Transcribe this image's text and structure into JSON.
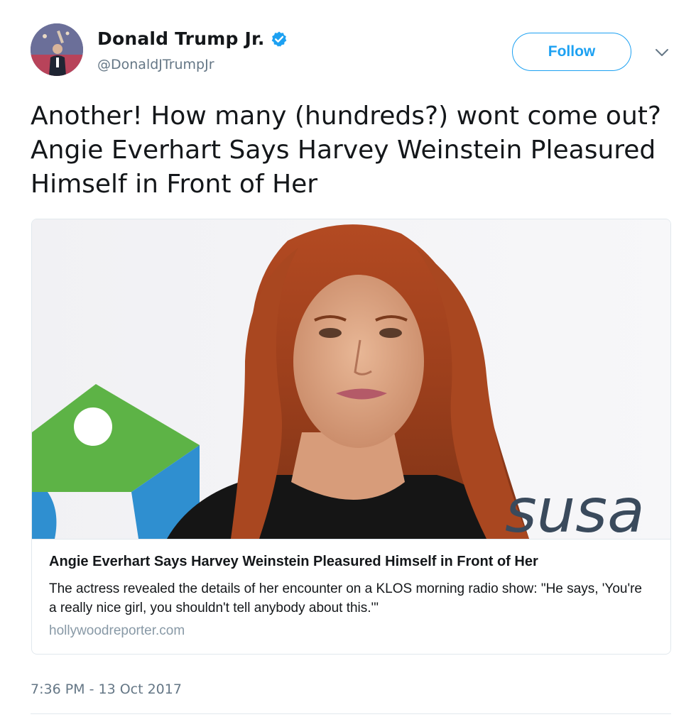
{
  "author": {
    "display_name": "Donald Trump Jr.",
    "handle": "@DonaldJTrumpJr",
    "verified": true,
    "avatar_icon": "profile-photo"
  },
  "actions": {
    "follow_label": "Follow",
    "menu_icon": "chevron-down-icon"
  },
  "tweet": {
    "text": "Another! How many (hundreds?) wont come out? Angie Everhart Says Harvey Weinstein Pleasured Himself in Front of Her",
    "timestamp": "7:36 PM - 13 Oct 2017"
  },
  "card": {
    "image_icon": "article-photo",
    "image_backdrop_text": "susa",
    "title": "Angie Everhart Says Harvey Weinstein Pleasured Himself in Front of Her",
    "description": "The actress revealed the details of her encounter on a KLOS morning radio show: \"He says, 'You're a really nice girl, you shouldn't tell anybody about this.'\"",
    "domain": "hollywoodreporter.com"
  },
  "colors": {
    "accent": "#1da1f2",
    "text_primary": "#14171a",
    "text_secondary": "#657786",
    "border": "#e1e8ed"
  }
}
